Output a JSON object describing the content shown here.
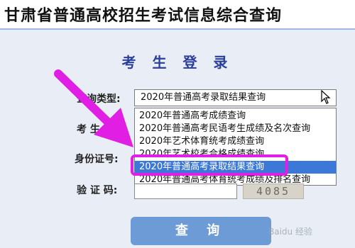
{
  "header": {
    "title": "甘肃省普通高校招生考试信息综合查询"
  },
  "form": {
    "title": "考 生 登 录",
    "query_type_label": "查询类型:",
    "exam_no_label": "考 生 号:",
    "id_label": "身份证号:",
    "captcha_label": "验 证 码:",
    "query_type_value": "2020年普通高考录取结果查询",
    "captcha_text": "4085",
    "submit_label": "查 询"
  },
  "dropdown": {
    "options": [
      "2020年普通高考成绩查询",
      "2020年普通高考民语考生成绩及名次查询",
      "2020年艺术体育统考成绩查询",
      "2020年艺术校考合格成绩查询",
      "2020年普通高考录取结果查询",
      "2020年普通高考体育统考成绩及排名查询"
    ],
    "selected_index": 4
  },
  "colors": {
    "accent": "#2a3e9a",
    "selection": "#3b78d8",
    "highlight": "#e11ee3",
    "button": "#6d9bd6"
  },
  "icons": {
    "dropdown": "chevron-down-icon",
    "pointer": "mouse-cursor-icon",
    "annotation": "arrow-icon"
  },
  "watermark": "Baidu 经验"
}
